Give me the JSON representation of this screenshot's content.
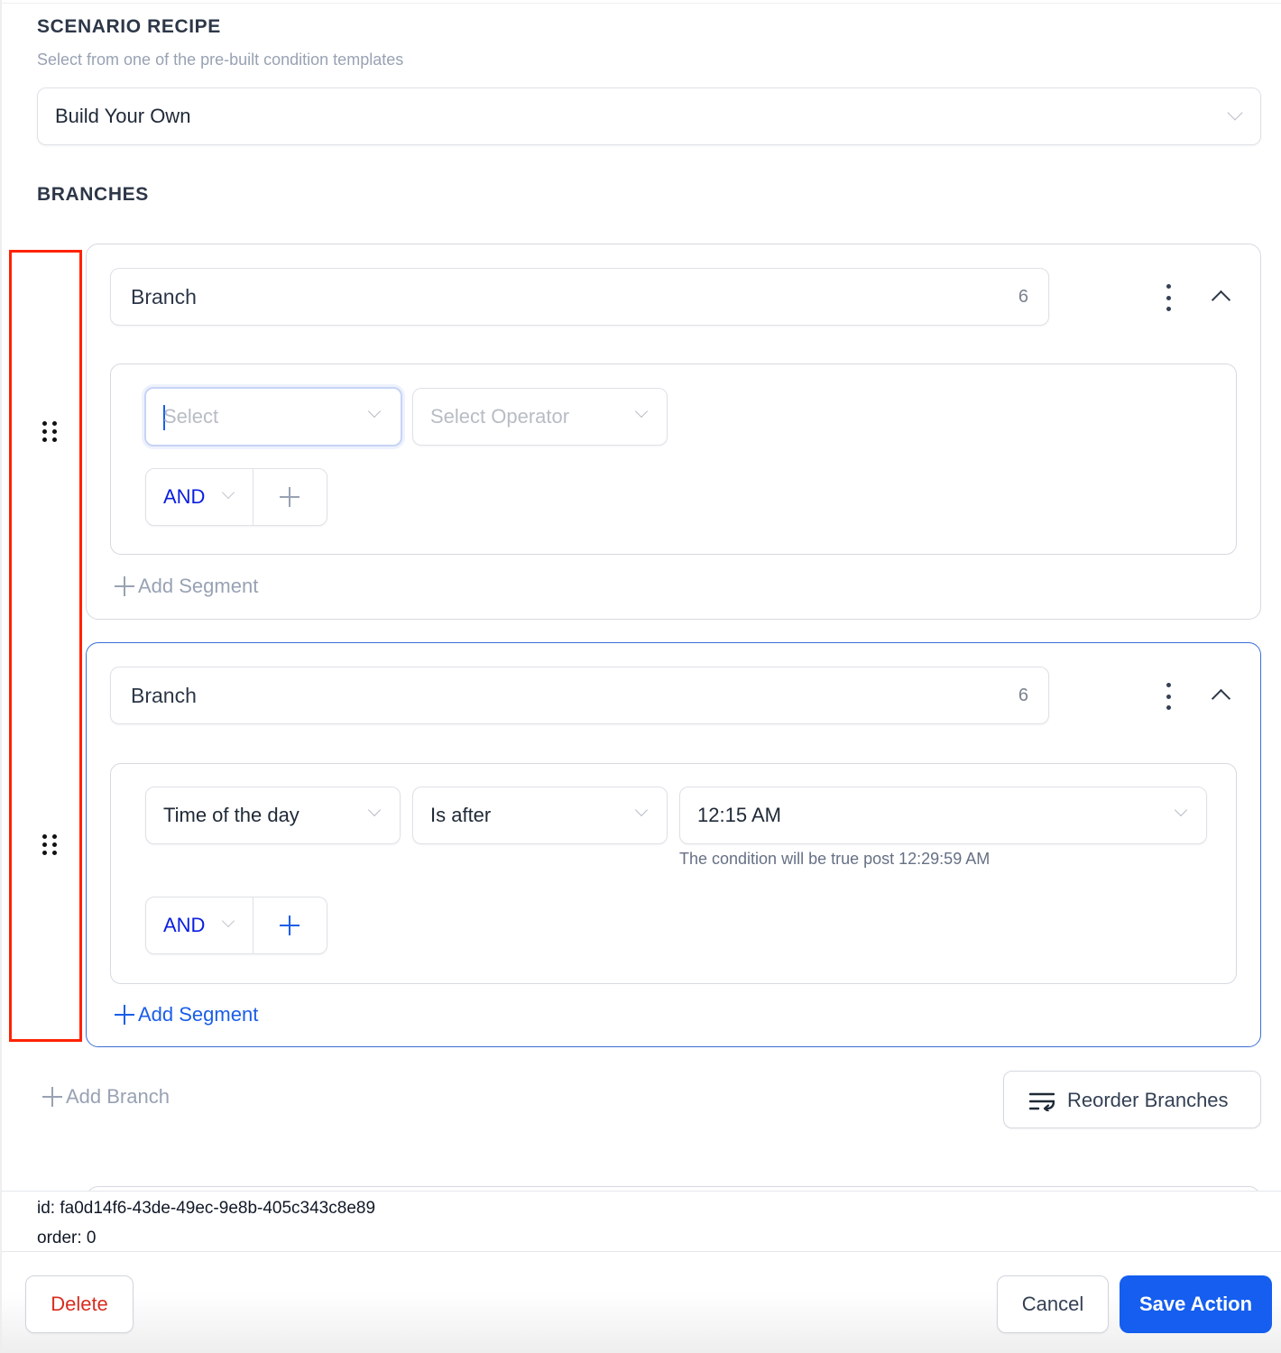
{
  "scenario_recipe": {
    "title": "SCENARIO RECIPE",
    "subtitle": "Select from one of the pre-built condition templates",
    "selected": "Build Your Own"
  },
  "branches_section": {
    "title": "BRANCHES",
    "branches": [
      {
        "name": "Branch",
        "count": "6",
        "active": false,
        "conditions": [
          {
            "field_placeholder": "Select",
            "operator_placeholder": "Select Operator"
          }
        ],
        "logic": "AND",
        "add_segment_label": "Add Segment"
      },
      {
        "name": "Branch",
        "count": "6",
        "active": true,
        "conditions": [
          {
            "field": "Time of the day",
            "operator": "Is after",
            "value": "12:15 AM",
            "hint": "The condition will be true post 12:29:59 AM"
          }
        ],
        "logic": "AND",
        "add_segment_label": "Add Segment"
      }
    ],
    "add_branch_label": "Add Branch",
    "reorder_label": "Reorder Branches"
  },
  "debug": {
    "id_line": "id: fa0d14f6-43de-49ec-9e8b-405c343c8e89",
    "order_line": "order: 0"
  },
  "footer": {
    "delete_label": "Delete",
    "cancel_label": "Cancel",
    "save_label": "Save Action"
  },
  "colors": {
    "primary": "#155eef",
    "danger": "#d92d20",
    "logic_text": "#0a1ee0",
    "highlight_outline": "#ff2200"
  }
}
